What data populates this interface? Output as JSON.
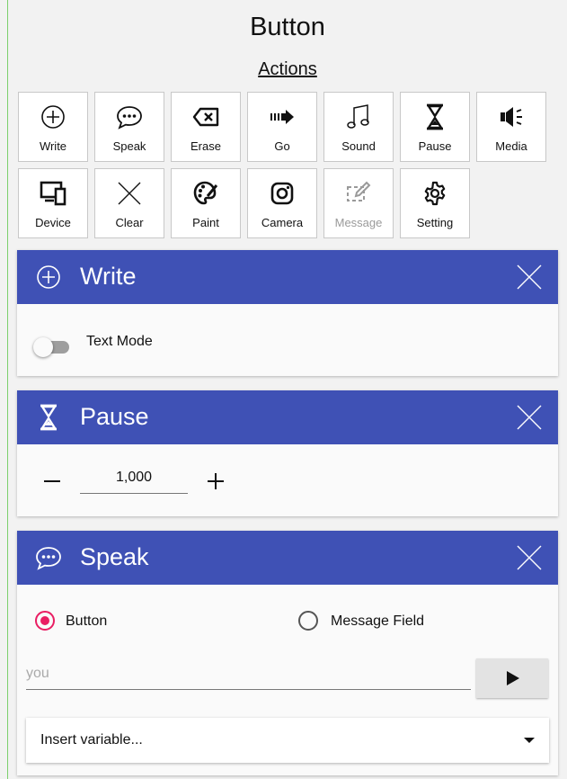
{
  "header": {
    "title": "Button",
    "actions_label": "Actions"
  },
  "actions": [
    {
      "label": "Write",
      "icon": "plus-circle-icon"
    },
    {
      "label": "Speak",
      "icon": "speech-bubble-icon"
    },
    {
      "label": "Erase",
      "icon": "backspace-icon"
    },
    {
      "label": "Go",
      "icon": "arrow-right-icon"
    },
    {
      "label": "Sound",
      "icon": "music-note-icon"
    },
    {
      "label": "Pause",
      "icon": "hourglass-icon"
    },
    {
      "label": "Media",
      "icon": "speaker-icon"
    },
    {
      "label": "Device",
      "icon": "devices-icon"
    },
    {
      "label": "Clear",
      "icon": "x-icon"
    },
    {
      "label": "Paint",
      "icon": "palette-icon"
    },
    {
      "label": "Camera",
      "icon": "camera-icon"
    },
    {
      "label": "Message",
      "icon": "edit-message-icon",
      "disabled": true
    },
    {
      "label": "Setting",
      "icon": "gear-icon"
    }
  ],
  "write_card": {
    "title": "Write",
    "toggle_label": "Text Mode",
    "toggle_on": false
  },
  "pause_card": {
    "title": "Pause",
    "value": "1,000"
  },
  "speak_card": {
    "title": "Speak",
    "option_button": "Button",
    "option_message_field": "Message Field",
    "selected": "Button",
    "input_placeholder": "you",
    "select_value": "Insert variable..."
  },
  "colors": {
    "header": "#3f51b5",
    "radio_selected": "#e91e63"
  }
}
